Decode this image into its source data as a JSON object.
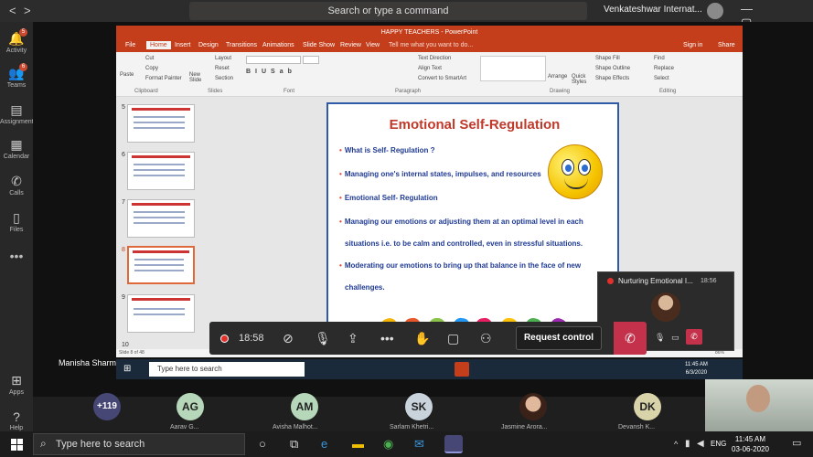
{
  "teams": {
    "search_placeholder": "Search or type a command",
    "org_name": "Venkateshwar Internat...",
    "nav_back": "<",
    "nav_forward": ">",
    "window_controls": "—  ▢  ✕"
  },
  "rail": {
    "items": [
      {
        "label": "Activity",
        "badge": "5"
      },
      {
        "label": "Teams",
        "badge": "6"
      },
      {
        "label": "Assignments",
        "badge": ""
      },
      {
        "label": "Calendar",
        "badge": ""
      },
      {
        "label": "Calls",
        "badge": ""
      },
      {
        "label": "Files",
        "badge": ""
      },
      {
        "label": "Apps",
        "badge": ""
      },
      {
        "label": "Help",
        "badge": ""
      }
    ]
  },
  "ppt": {
    "title": "HAPPY TEACHERS - PowerPoint",
    "tabs": [
      "File",
      "Home",
      "Insert",
      "Design",
      "Transitions",
      "Animations",
      "Slide Show",
      "Review",
      "View",
      "Tell me what you want to do..."
    ],
    "signin": "Sign in",
    "share": "Share",
    "ribbon_groups": [
      "Clipboard",
      "Slides",
      "Font",
      "Paragraph",
      "Drawing",
      "Editing"
    ],
    "ribbon_items": {
      "paste": "Paste",
      "cut": "Cut",
      "copy": "Copy",
      "format_painter": "Format Painter",
      "new_slide": "New Slide",
      "layout": "Layout",
      "reset": "Reset",
      "section": "Section",
      "text_direction": "Text Direction",
      "align_text": "Align Text",
      "convert_smartart": "Convert to SmartArt",
      "arrange": "Arrange",
      "quick_styles": "Quick Styles",
      "shape_fill": "Shape Fill",
      "shape_outline": "Shape Outline",
      "shape_effects": "Shape Effects",
      "find": "Find",
      "replace": "Replace",
      "select": "Select"
    },
    "thumb_numbers": [
      "5",
      "6",
      "7",
      "8",
      "9",
      "10"
    ],
    "status": "Slide 8 of 48",
    "zoom": "86%",
    "slide": {
      "title": "Emotional Self-Regulation",
      "bullets": [
        "What is Self- Regulation ?",
        "Managing one's internal states, impulses, and resources",
        "Emotional Self- Regulation",
        "Managing our emotions or adjusting them at an optimal level in each",
        "Moderating our emotions to bring up that balance in the face of new"
      ],
      "continuations": [
        "situations i.e. to be calm and controlled, even in stressful situations.",
        "challenges."
      ]
    }
  },
  "meeting": {
    "timer": "18:58",
    "request_control": "Request control",
    "mini_title": "Nurturing Emotional I...",
    "mini_time": "18:56",
    "presenter": "Manisha Sharma"
  },
  "inner_taskbar": {
    "search_placeholder": "Type here to search",
    "time": "11:45 AM",
    "date": "6/3/2020"
  },
  "participants": {
    "more_count": "+119",
    "people": [
      {
        "initials": "AG",
        "name": "Aarav G...",
        "color": "#b6d7b9"
      },
      {
        "initials": "AM",
        "name": "Avisha Malhot...",
        "color": "#b6d7b9"
      },
      {
        "initials": "SK",
        "name": "Sarlam Khetri...",
        "color": "#c9d3dc"
      },
      {
        "initials": "",
        "name": "Jasmine Arora...",
        "color": "#d7c4b6"
      },
      {
        "initials": "DK",
        "name": "Devansh K...",
        "color": "#d8d3a8"
      }
    ]
  },
  "taskbar": {
    "search_placeholder": "Type here to search",
    "lang": "ENG",
    "time": "11:45 AM",
    "date": "03-06-2020"
  }
}
